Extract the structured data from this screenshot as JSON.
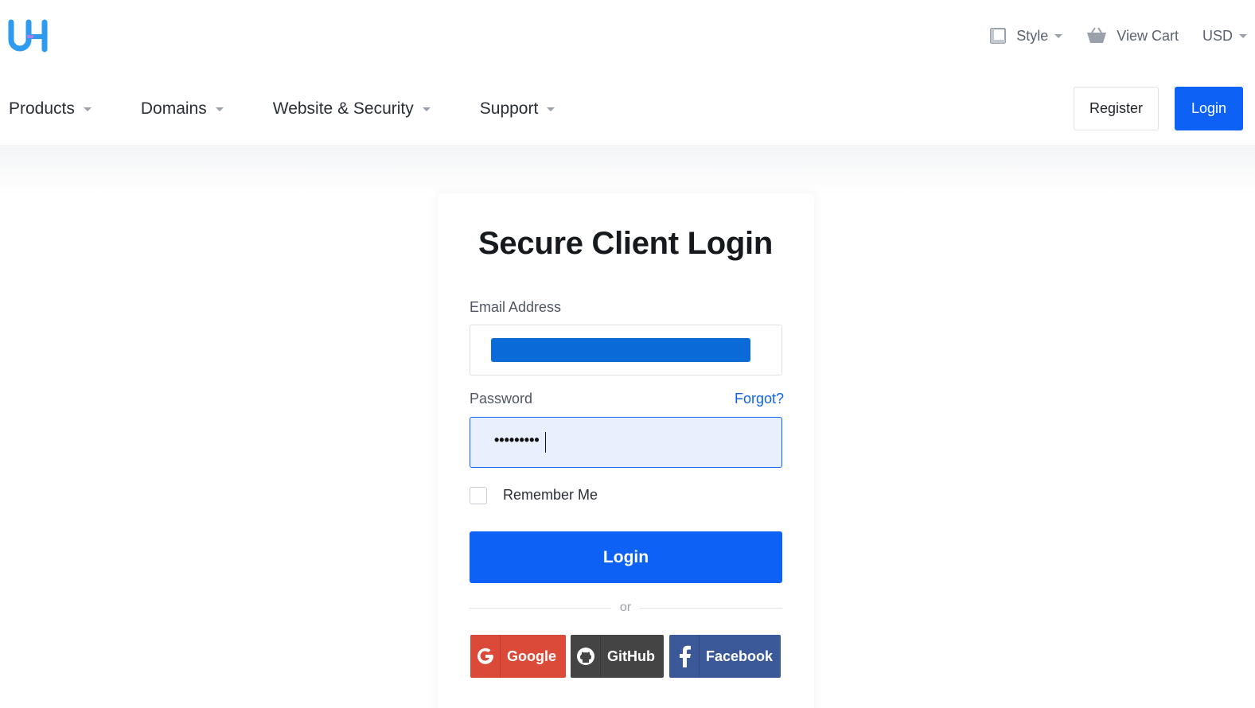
{
  "brand": {
    "logo_text": "UH",
    "colors": {
      "primary": "#0d62f5",
      "logo": "#2e9bf0"
    }
  },
  "topbar": {
    "style": {
      "label": "Style",
      "icon": "style-frame-icon"
    },
    "cart": {
      "label": "View Cart",
      "icon": "basket-icon"
    },
    "currency": {
      "label": "USD"
    }
  },
  "nav": {
    "items": [
      {
        "label": "Products"
      },
      {
        "label": "Domains"
      },
      {
        "label": "Website & Security"
      },
      {
        "label": "Support"
      }
    ],
    "register_label": "Register",
    "login_label": "Login"
  },
  "login_form": {
    "title": "Secure Client Login",
    "email_label": "Email Address",
    "email_value": "",
    "password_label": "Password",
    "password_value": "•••••••••",
    "forgot_label": "Forgot?",
    "remember_label": "Remember Me",
    "remember_checked": false,
    "submit_label": "Login",
    "or_label": "or",
    "social": [
      {
        "label": "Google",
        "color": "#db4a39",
        "icon": "google-icon"
      },
      {
        "label": "GitHub",
        "color": "#444444",
        "icon": "github-icon"
      },
      {
        "label": "Facebook",
        "color": "#3b5998",
        "icon": "facebook-icon"
      }
    ]
  }
}
